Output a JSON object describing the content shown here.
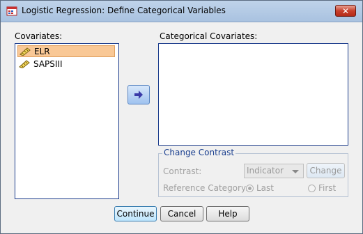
{
  "window": {
    "title": "Logistic Regression: Define Categorical Variables",
    "close_label": "✕"
  },
  "covariates": {
    "label": "Covariates:",
    "items": [
      "ELR",
      "SAPSIII"
    ]
  },
  "categorical": {
    "label": "Categorical Covariates:"
  },
  "change_contrast": {
    "group_label": "Change Contrast",
    "contrast_label": "Contrast:",
    "contrast_value": "Indicator",
    "change_button": "Change",
    "reference_label": "Reference Category:",
    "last_label": "Last",
    "first_label": "First"
  },
  "buttons": {
    "continue": "Continue",
    "cancel": "Cancel",
    "help": "Help"
  }
}
